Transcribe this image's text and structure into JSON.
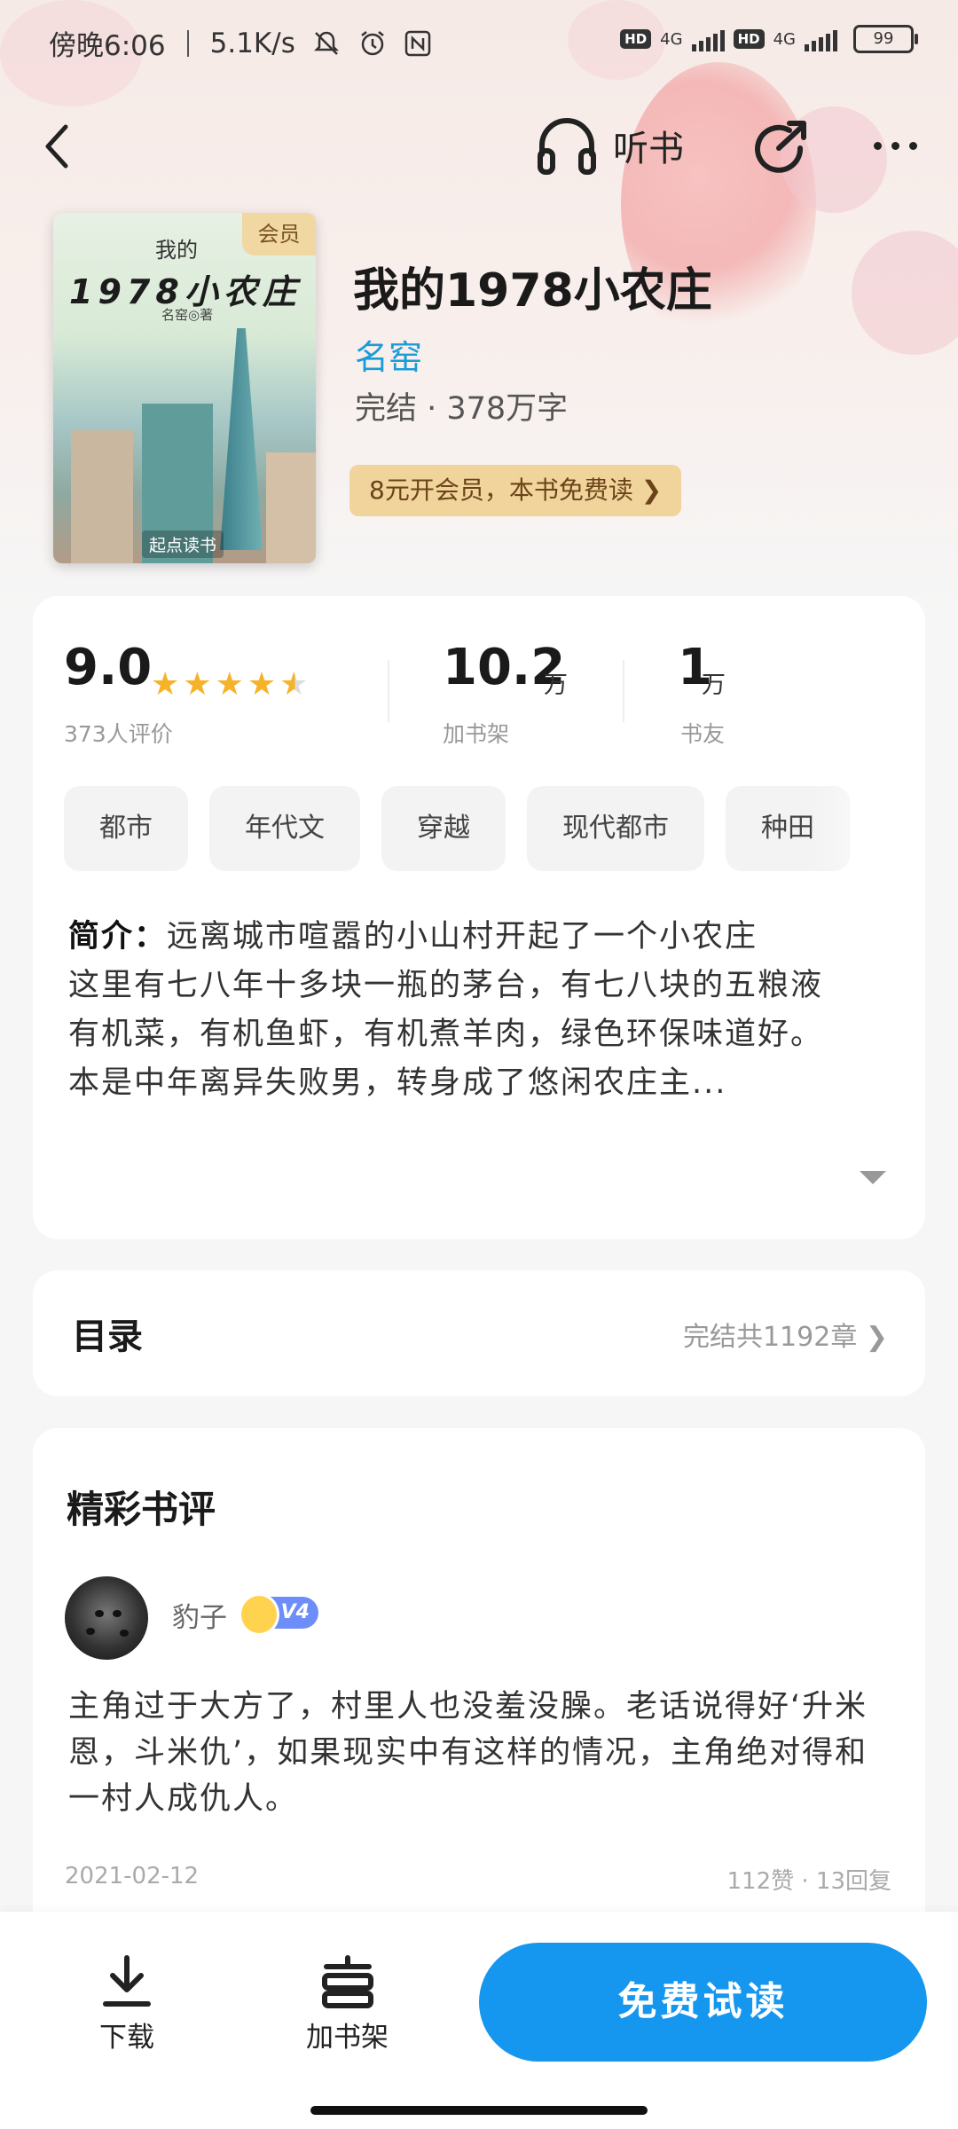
{
  "status_bar": {
    "time": "傍晚6:06",
    "net_speed": "5.1K/s",
    "net_type_1": "4G",
    "net_type_2": "4G",
    "hd_1": "HD",
    "hd_2": "HD",
    "battery": "99"
  },
  "nav": {
    "listen_label": "听书"
  },
  "book": {
    "title": "我的1978小农庄",
    "author": "名窑",
    "status_words": "完结 · 378万字",
    "vip_badge": "会员",
    "vip_promo": "8元开会员，本书免费读 ❯",
    "cover": {
      "title_small": "我的",
      "title_main": "1978小农庄",
      "author_line": "名窑◎著",
      "publisher": "起点读书"
    }
  },
  "stats": {
    "rating": "9.0",
    "rating_count": "373人评价",
    "shelf_num": "10.2",
    "shelf_unit": "万",
    "shelf_label": "加书架",
    "fans_num": "1",
    "fans_unit": "万",
    "fans_label": "书友",
    "stars": 4.5
  },
  "tags": [
    "都市",
    "年代文",
    "穿越",
    "现代都市",
    "种田"
  ],
  "intro": {
    "label": "简介：",
    "line1": "远离城市喧嚣的小山村开起了一个小农庄",
    "line2": "这里有七八年十多块一瓶的茅台，有七八块的五粮液",
    "line3": "有机菜，有机鱼虾，有机煮羊肉，绿色环保味道好。",
    "line4": "本是中年离异失败男，转身成了悠闲农庄主..."
  },
  "toc": {
    "title": "目录",
    "summary": "完结共1192章 ❯"
  },
  "reviews": {
    "title": "精彩书评",
    "items": [
      {
        "user": "豹子",
        "level": "V4",
        "content": "主角过于大方了，村里人也没羞没臊。老话说得好‘升米恩，斗米仇’，如果现实中有这样的情况，主角绝对得和一村人成仇人。",
        "date": "2021-02-12",
        "stats": "112赞 · 13回复"
      }
    ]
  },
  "bottom_bar": {
    "download_label": "下载",
    "shelf_label": "加书架",
    "read_button": "免费试读"
  },
  "colors": {
    "accent_blue": "#1596ef",
    "author_blue": "#1a9cd6",
    "star": "#f6b32a",
    "vip_gold": "#f1d49c"
  }
}
